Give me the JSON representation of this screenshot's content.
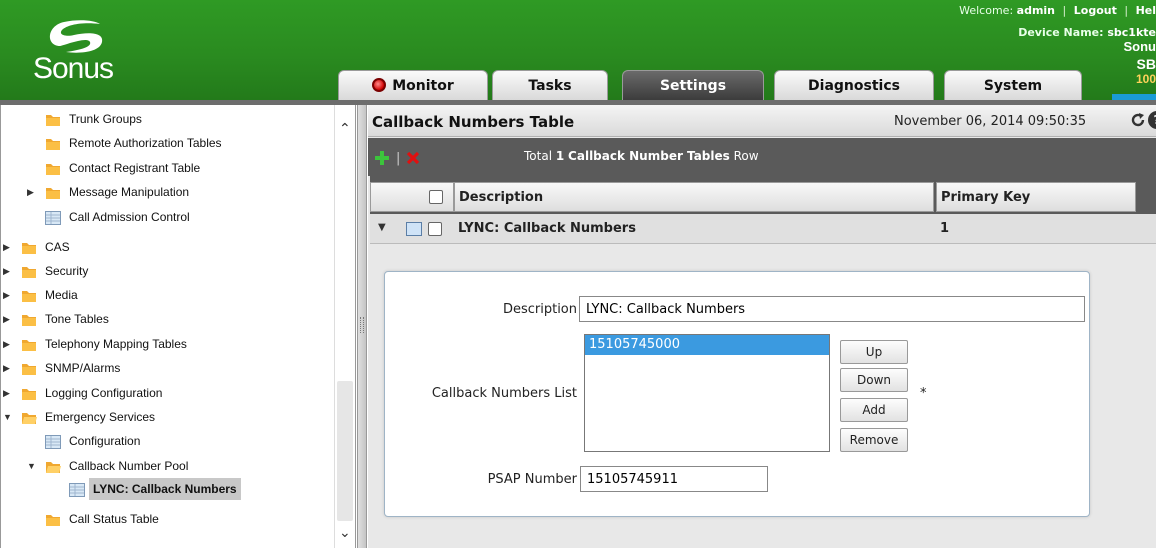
{
  "header": {
    "logo_text": "Sonus",
    "welcome_prefix": "Welcome:",
    "username": "admin",
    "logout": "Logout",
    "help": "Hel",
    "device_label": "Device Name:",
    "device_value": "sbc1kte",
    "brand_1": "Sonu",
    "brand_2": "SB",
    "brand_3": "100",
    "accent_color": "#2f9a24"
  },
  "tabs": [
    {
      "label": "Monitor",
      "active": false
    },
    {
      "label": "Tasks",
      "active": false
    },
    {
      "label": "Settings",
      "active": true
    },
    {
      "label": "Diagnostics",
      "active": false
    },
    {
      "label": "System",
      "active": false
    }
  ],
  "sidebar": {
    "items": [
      {
        "label": "Trunk Groups",
        "icon": "folder-icon"
      },
      {
        "label": "Remote Authorization Tables",
        "icon": "folder-icon"
      },
      {
        "label": "Contact Registrant Table",
        "icon": "folder-icon"
      },
      {
        "label": "Message Manipulation",
        "icon": "folder-icon"
      },
      {
        "label": "Call Admission Control",
        "icon": "table-icon"
      },
      {
        "label": "CAS",
        "icon": "folder-icon"
      },
      {
        "label": "Security",
        "icon": "folder-icon"
      },
      {
        "label": "Media",
        "icon": "folder-icon"
      },
      {
        "label": "Tone Tables",
        "icon": "folder-icon"
      },
      {
        "label": "Telephony Mapping Tables",
        "icon": "folder-icon"
      },
      {
        "label": "SNMP/Alarms",
        "icon": "folder-icon"
      },
      {
        "label": "Logging Configuration",
        "icon": "folder-icon"
      },
      {
        "label": "Emergency Services",
        "icon": "folder-open-icon"
      },
      {
        "label": "Configuration",
        "icon": "table-icon"
      },
      {
        "label": "Callback Number Pool",
        "icon": "folder-open-icon"
      },
      {
        "label": "LYNC: Callback Numbers",
        "icon": "table-icon",
        "selected": true
      },
      {
        "label": "Call Status Table",
        "icon": "folder-icon"
      }
    ]
  },
  "main": {
    "title": "Callback Numbers Table",
    "datetime": "November 06, 2014 09:50:35",
    "total_prefix": "Total",
    "total_count": "1",
    "total_name": "Callback Number Tables",
    "total_suffix": "Row",
    "columns": {
      "description": "Description",
      "primary_key": "Primary Key"
    },
    "row": {
      "description": "LYNC: Callback Numbers",
      "primary_key": "1"
    }
  },
  "form": {
    "description_label": "Description",
    "description_value": "LYNC: Callback Numbers",
    "list_label": "Callback Numbers List",
    "list_items": [
      "15105745000"
    ],
    "btn_up": "Up",
    "btn_down": "Down",
    "btn_add": "Add",
    "btn_remove": "Remove",
    "required_mark": "*",
    "psap_label": "PSAP Number",
    "psap_value": "15105745911"
  }
}
